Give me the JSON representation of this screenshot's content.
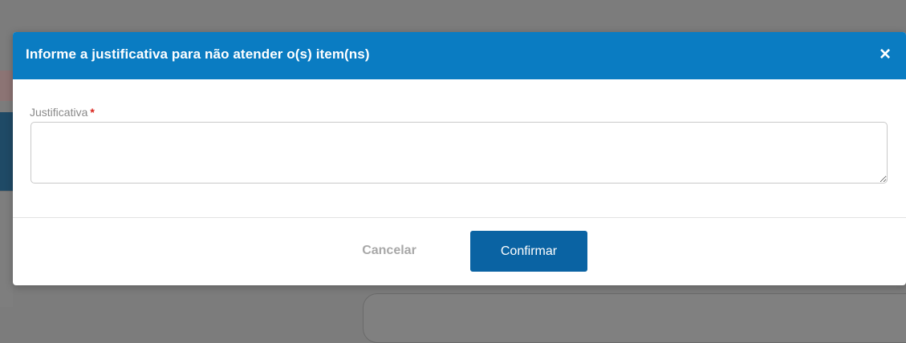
{
  "modal": {
    "title": "Informe a justificativa para não atender o(s) item(ns)",
    "close_icon": "×",
    "field": {
      "label": "Justificativa",
      "required_mark": "*",
      "value": "",
      "placeholder": ""
    },
    "buttons": {
      "cancel_label": "Cancelar",
      "confirm_label": "Confirmar"
    }
  },
  "colors": {
    "header": "#0a7cc2",
    "confirm": "#0a63a3",
    "required": "#d9241c"
  }
}
